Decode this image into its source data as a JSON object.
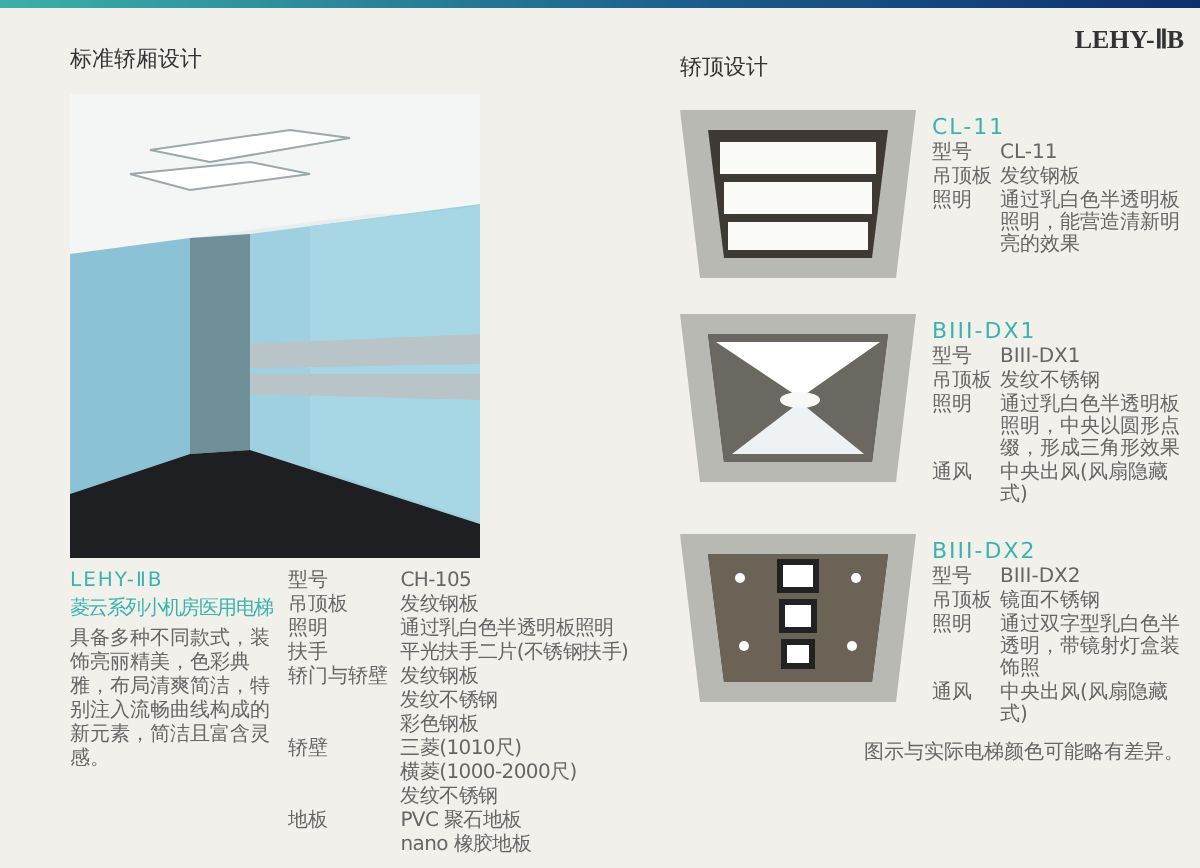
{
  "left": {
    "heading": "标准轿厢设计",
    "model": "LEHY-ⅡB",
    "title": "菱云系列小机房医用电梯",
    "description": "具备多种不同款式，装饰亮丽精美，色彩典雅，布局清爽简洁，特别注入流畅曲线构成的新元素，简洁且富含灵感。",
    "specs": [
      {
        "label": "型号",
        "values": [
          "CH-105"
        ]
      },
      {
        "label": "吊顶板",
        "values": [
          "发纹钢板"
        ]
      },
      {
        "label": "照明",
        "values": [
          "通过乳白色半透明板照明"
        ]
      },
      {
        "label": "扶手",
        "values": [
          "平光扶手二片(不锈钢扶手)"
        ]
      },
      {
        "label": "轿门与轿壁",
        "values": [
          "发纹钢板",
          "发纹不锈钢",
          "彩色钢板"
        ]
      },
      {
        "label": "轿壁",
        "values": [
          "三菱(1010尺)",
          "横菱(1000-2000尺)",
          "发纹不锈钢"
        ]
      },
      {
        "label": "地板",
        "values": [
          "PVC 聚石地板",
          "nano 橡胶地板"
        ]
      }
    ]
  },
  "right": {
    "heading": "轿顶设计",
    "logo": "LEHY-ⅡB",
    "ceilings": [
      {
        "kind": "panels",
        "name": "CL-11",
        "specs": [
          {
            "label": "型号",
            "value": "CL-11"
          },
          {
            "label": "吊顶板",
            "value": "发纹钢板"
          },
          {
            "label": "照明",
            "value": "通过乳白色半透明板照明，能营造清新明亮的效果"
          }
        ]
      },
      {
        "kind": "dome",
        "name": "BIII-DX1",
        "specs": [
          {
            "label": "型号",
            "value": "BIII-DX1"
          },
          {
            "label": "吊顶板",
            "value": "发纹不锈钢"
          },
          {
            "label": "照明",
            "value": "通过乳白色半透明板照明，中央以圆形点缀，形成三角形效果"
          },
          {
            "label": "通风",
            "value": "中央出风(风扇隐藏式)"
          }
        ]
      },
      {
        "kind": "spots",
        "name": "BIII-DX2",
        "specs": [
          {
            "label": "型号",
            "value": "BIII-DX2"
          },
          {
            "label": "吊顶板",
            "value": "镜面不锈钢"
          },
          {
            "label": "照明",
            "value": "通过双字型乳白色半透明，带镜射灯盒装饰照"
          },
          {
            "label": "通风",
            "value": "中央出风(风扇隐藏式)"
          }
        ]
      }
    ],
    "footnote": "图示与实际电梯颜色可能略有差异。"
  }
}
